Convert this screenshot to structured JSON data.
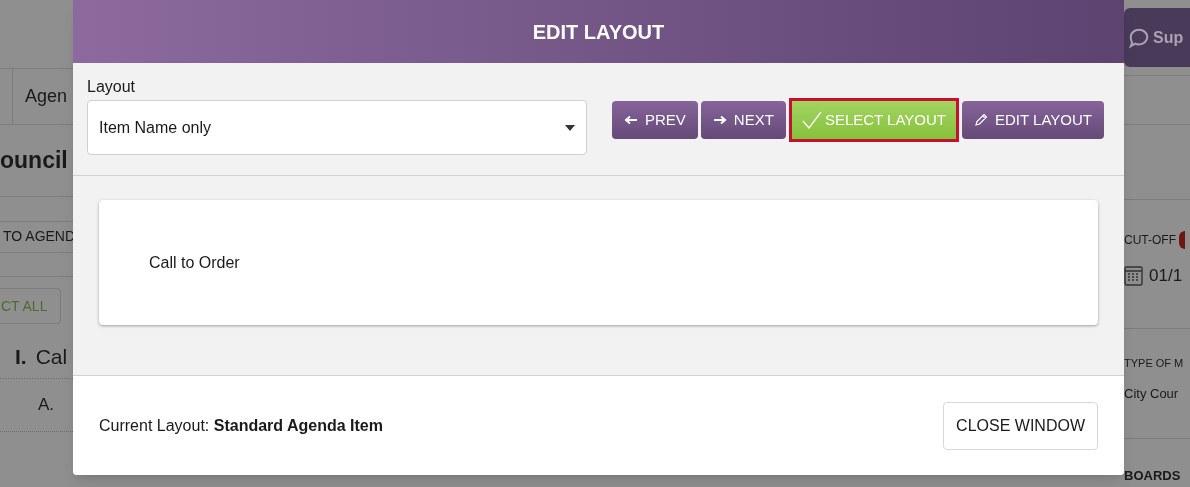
{
  "background": {
    "left": {
      "tab": "Agen",
      "heading": "ouncil",
      "add_button": "TO AGEND",
      "select_all_button": "CT ALL",
      "section_number": "I.",
      "section_title": "Cal",
      "item_letter": "A."
    },
    "right": {
      "support_button": "Sup",
      "cutoff_label": "CUT-OFF",
      "cutoff_date": "01/1",
      "type_label": "TYPE OF M",
      "type_value": "City Cour",
      "boards_label": "BOARDS"
    }
  },
  "modal": {
    "title": "EDIT LAYOUT",
    "layout_label": "Layout",
    "layout_value": "Item Name only",
    "buttons": [
      {
        "kind": "prev",
        "label": "PREV",
        "selected": false
      },
      {
        "kind": "next",
        "label": "NEXT",
        "selected": false
      },
      {
        "kind": "select",
        "label": "SELECT LAYOUT",
        "selected": true
      },
      {
        "kind": "edit",
        "label": "EDIT LAYOUT",
        "selected": false
      }
    ],
    "preview_items": [
      "Call to Order"
    ],
    "current_layout_label": "Current Layout:",
    "current_layout_value": "Standard Agenda Item",
    "close_button": "CLOSE WINDOW"
  }
}
